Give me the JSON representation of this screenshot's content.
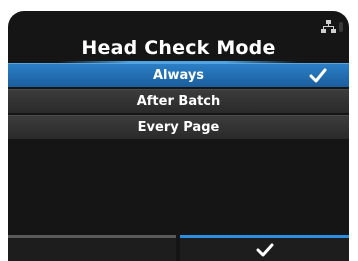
{
  "screen": {
    "title": "Head Check Mode",
    "status_icons": [
      "network-icon"
    ]
  },
  "options": [
    {
      "label": "Always",
      "selected": true
    },
    {
      "label": "After Batch",
      "selected": false
    },
    {
      "label": "Every Page",
      "selected": false
    }
  ],
  "softkeys": {
    "left": {
      "label": ""
    },
    "right": {
      "icon": "check-icon"
    }
  },
  "colors": {
    "background": "#151515",
    "selected_row": "#2c7fc6",
    "row": "#333333",
    "accent": "#2a8fe0",
    "text": "#ffffff"
  }
}
